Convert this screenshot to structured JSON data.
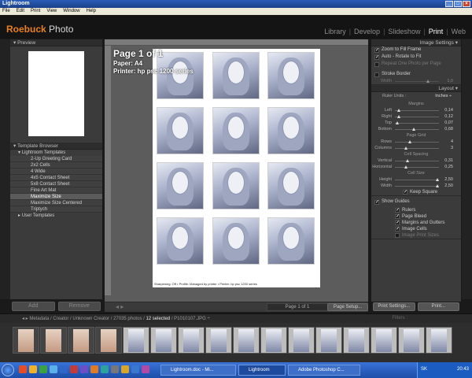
{
  "window": {
    "title": "Lightroom",
    "buttons": [
      "_",
      "□",
      "×"
    ]
  },
  "menu": [
    "File",
    "Edit",
    "Print",
    "View",
    "Window",
    "Help"
  ],
  "identity": {
    "brand_a": "Roebuck",
    "brand_b": " Photo"
  },
  "modules": {
    "items": [
      "Library",
      "Develop",
      "Slideshow",
      "Print",
      "Web"
    ],
    "active": "Print",
    "separator": "|"
  },
  "left_panel": {
    "preview_header": "Preview",
    "template_header": "Template Browser",
    "group": "Lightroom Templates",
    "templates": [
      "2-Up Greeting Card",
      "2x2 Cells",
      "4 Wide",
      "4x5 Contact Sheet",
      "5x8 Contact Sheet",
      "Fine Art Mat",
      "Maximize Size",
      "Maximize Size Centered",
      "Triptych"
    ],
    "selected_template": "Maximize Size",
    "user_group": "User Templates",
    "add_label": "Add",
    "remove_label": "Remove"
  },
  "page_overlay": {
    "title": "Page 1 of 1",
    "paper": "Paper:  A4",
    "printer": "Printer:  hp psc 1200 series"
  },
  "page_footer": "Sharpening: Off • Profile: Managed by printer • Printer: hp psc 1200 series",
  "page_bar": {
    "indicator": "Page 1 of 1",
    "page_setup": "Page Setup...",
    "arrows": "◂ ▸"
  },
  "right_panel": {
    "image_settings_header": "Image Settings",
    "image_settings": [
      {
        "label": "Zoom to Fill Frame",
        "checked": true
      },
      {
        "label": "Auto - Rotate to Fit",
        "checked": true
      },
      {
        "label": "Repeat One Photo per Page",
        "checked": false
      }
    ],
    "stroke_border": "Stroke Border",
    "stroke_width_label": "Width",
    "stroke_width_value": "1,0",
    "layout_header": "Layout",
    "ruler_units_label": "Ruler Units :",
    "ruler_units_value": "Inches ÷",
    "margins_title": "Margins",
    "margins": [
      {
        "label": "Left",
        "value": "0,14",
        "pos": 0.1
      },
      {
        "label": "Right",
        "value": "0,12",
        "pos": 0.09
      },
      {
        "label": "Top",
        "value": "0,07",
        "pos": 0.05
      },
      {
        "label": "Bottom",
        "value": "0,68",
        "pos": 0.45
      }
    ],
    "grid_title": "Page Grid",
    "grid": [
      {
        "label": "Rows",
        "value": "4",
        "pos": 0.35
      },
      {
        "label": "Columns",
        "value": "3",
        "pos": 0.25
      }
    ],
    "spacing_title": "Cell Spacing",
    "spacing": [
      {
        "label": "Vertical",
        "value": "0,31",
        "pos": 0.3
      },
      {
        "label": "Horizontal",
        "value": "0,25",
        "pos": 0.25
      }
    ],
    "cellsize_title": "Cell Size",
    "cellsize": [
      {
        "label": "Height",
        "value": "2,50",
        "pos": 1.0
      },
      {
        "label": "Width",
        "value": "2,50",
        "pos": 1.0
      }
    ],
    "keep_square": "Keep Square",
    "show_guides_label": "Show Guides",
    "guides": [
      {
        "label": "Rulers",
        "checked": true
      },
      {
        "label": "Page Bleed",
        "checked": true
      },
      {
        "label": "Margins and Gutters",
        "checked": true
      },
      {
        "label": "Image Cells",
        "checked": true
      },
      {
        "label": "Image Print Sizes",
        "checked": false
      }
    ],
    "print_settings_label": "Print Settings...",
    "print_label": "Print..."
  },
  "filmstrip_bar": {
    "path": "Metadata / Creator / Unknown Creator / 27035 photos /",
    "selected": " 12 selected ",
    "file": "/ P1010107.JPG ÷",
    "filters": "Filters :"
  },
  "taskbar": {
    "items": [
      "Lightroom.doc - Mi...",
      "Lightroom",
      "Adobe Photoshop C..."
    ],
    "active": "Lightroom",
    "lang": "SK",
    "clock": "20:43"
  },
  "colors": {
    "accent": "#e87f1d",
    "panel": "#3b3b3b",
    "background": "#1a1a1a"
  }
}
